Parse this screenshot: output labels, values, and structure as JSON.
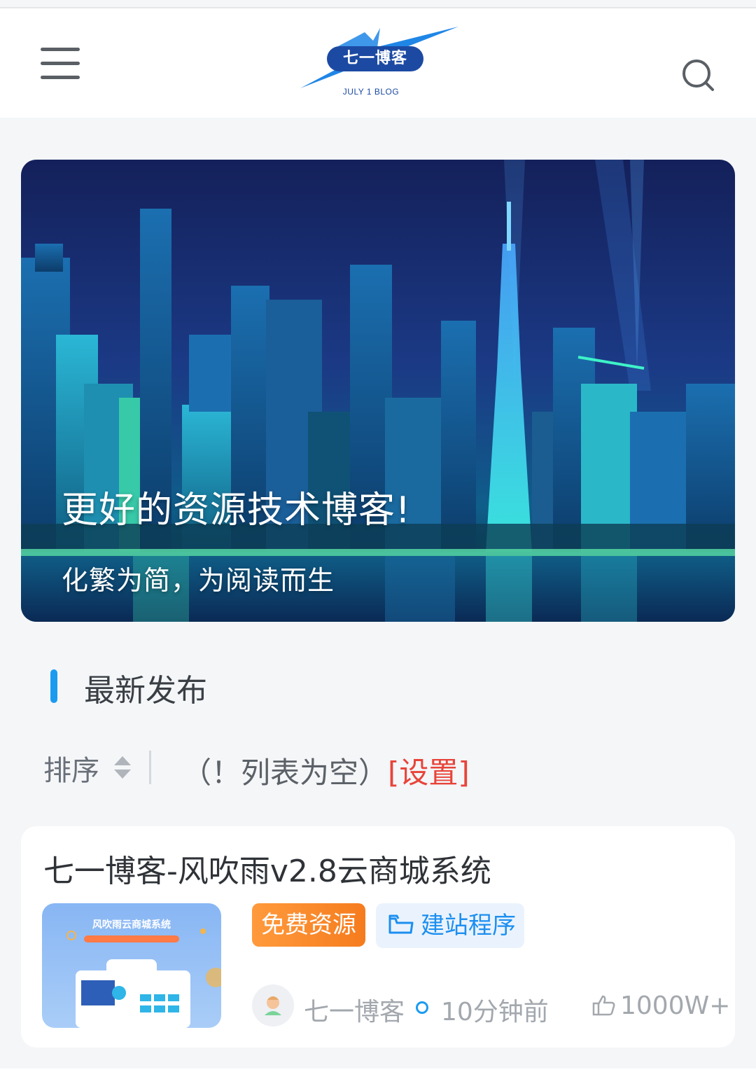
{
  "header": {
    "logo_text": "七一博客",
    "logo_sub": "JULY 1 BLOG",
    "menu_icon": "hamburger-menu-icon",
    "search_icon": "search-icon"
  },
  "banner": {
    "title": "更好的资源技术博客!",
    "subtitle": "化繁为简，为阅读而生"
  },
  "section": {
    "title": "最新发布"
  },
  "sortbar": {
    "sort_label": "排序",
    "empty_text": "（！列表为空）",
    "settings_link": "[设置]"
  },
  "posts": [
    {
      "title": "七一博客-风吹雨v2.8云商城系统",
      "thumb_caption": "风吹雨云商城系统",
      "tag_free": "免费资源",
      "category": "建站程序",
      "author": "七一博客",
      "time": "10分钟前",
      "likes": "1000W+"
    }
  ],
  "colors": {
    "accent": "#1b9bf0",
    "link_red": "#e8443a",
    "tag_orange": "#f57c1e"
  }
}
